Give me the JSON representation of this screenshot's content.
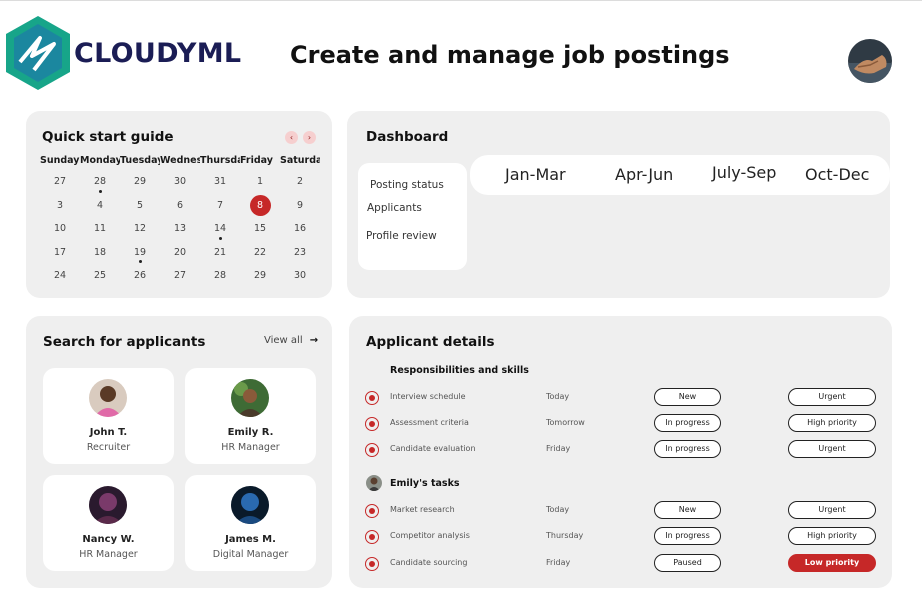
{
  "header": {
    "brand": "CLOUDYML",
    "title": "Create and manage job postings"
  },
  "colors": {
    "brand": "#1b1d55",
    "accent": "#c62828",
    "logo_teal": "#17a589"
  },
  "calendar": {
    "title": "Quick start guide",
    "prev_icon": "‹",
    "next_icon": "›",
    "weekdays": [
      "Sunday",
      "Monday",
      "Tuesday",
      "Wednesday",
      "Thursday",
      "Friday",
      "Saturday"
    ],
    "days": [
      [
        "27",
        "28",
        "29",
        "30",
        "31",
        "1",
        "2"
      ],
      [
        "3",
        "4",
        "5",
        "6",
        "7",
        "8",
        "9"
      ],
      [
        "10",
        "11",
        "12",
        "13",
        "14",
        "15",
        "16"
      ],
      [
        "17",
        "18",
        "19",
        "20",
        "21",
        "22",
        "23"
      ],
      [
        "24",
        "25",
        "26",
        "27",
        "28",
        "29",
        "30"
      ]
    ],
    "selected_day": "8"
  },
  "dashboard": {
    "title": "Dashboard",
    "menu": [
      "Posting status",
      "Applicants",
      "Profile review"
    ],
    "quarters": [
      "Jan-Mar",
      "Apr-Jun",
      "July-Sep",
      "Oct-Dec"
    ]
  },
  "search": {
    "title": "Search for applicants",
    "view_all": "View all",
    "applicants": [
      {
        "name": "John T.",
        "role": "Recruiter"
      },
      {
        "name": "Emily R.",
        "role": "HR Manager"
      },
      {
        "name": "Nancy W.",
        "role": "HR Manager"
      },
      {
        "name": "James M.",
        "role": "Digital Manager"
      }
    ]
  },
  "details": {
    "title": "Applicant details",
    "group1": {
      "title": "Responsibilities and skills",
      "rows": [
        {
          "task": "Interview schedule",
          "when": "Today",
          "status": "New",
          "priority": "Urgent"
        },
        {
          "task": "Assessment criteria",
          "when": "Tomorrow",
          "status": "In progress",
          "priority": "High priority"
        },
        {
          "task": "Candidate evaluation",
          "when": "Friday",
          "status": "In progress",
          "priority": "Urgent"
        }
      ]
    },
    "group2": {
      "title": "Emily's tasks",
      "rows": [
        {
          "task": "Market research",
          "when": "Today",
          "status": "New",
          "priority": "Urgent"
        },
        {
          "task": "Competitor analysis",
          "when": "Thursday",
          "status": "In progress",
          "priority": "High priority"
        },
        {
          "task": "Candidate sourcing",
          "when": "Friday",
          "status": "Paused",
          "priority": "Low priority"
        }
      ]
    }
  }
}
